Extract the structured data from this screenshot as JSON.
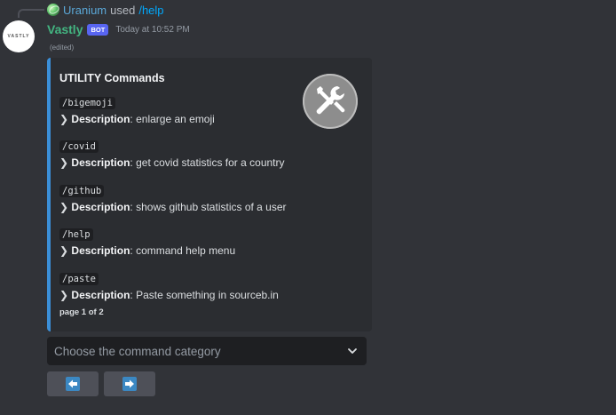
{
  "reply": {
    "user": "Uranium",
    "verb": "used",
    "command": "/help"
  },
  "message": {
    "avatar_text": "VASTLY",
    "author": "Vastly",
    "bot_tag": "BOT",
    "timestamp": "Today at 10:52 PM",
    "edited": "(edited)",
    "colors": {
      "author": "#43b581",
      "embed_accent": "#3b8fd8",
      "bot_tag": "#5865f2"
    }
  },
  "embed": {
    "title": "UTILITY Commands",
    "thumbnail_icon": "tools-icon",
    "description_label": "Description",
    "fields": [
      {
        "name": "/bigemoji",
        "description": "enlarge an emoji"
      },
      {
        "name": "/covid",
        "description": "get covid statistics for a country"
      },
      {
        "name": "/github",
        "description": "shows github statistics of a user"
      },
      {
        "name": "/help",
        "description": "command help menu"
      },
      {
        "name": "/paste",
        "description": "Paste something in sourceb.in"
      }
    ],
    "footer": "page 1 of 2"
  },
  "components": {
    "select_placeholder": "Choose the command category",
    "prev_icon": "arrow-left-icon",
    "next_icon": "arrow-right-icon"
  }
}
